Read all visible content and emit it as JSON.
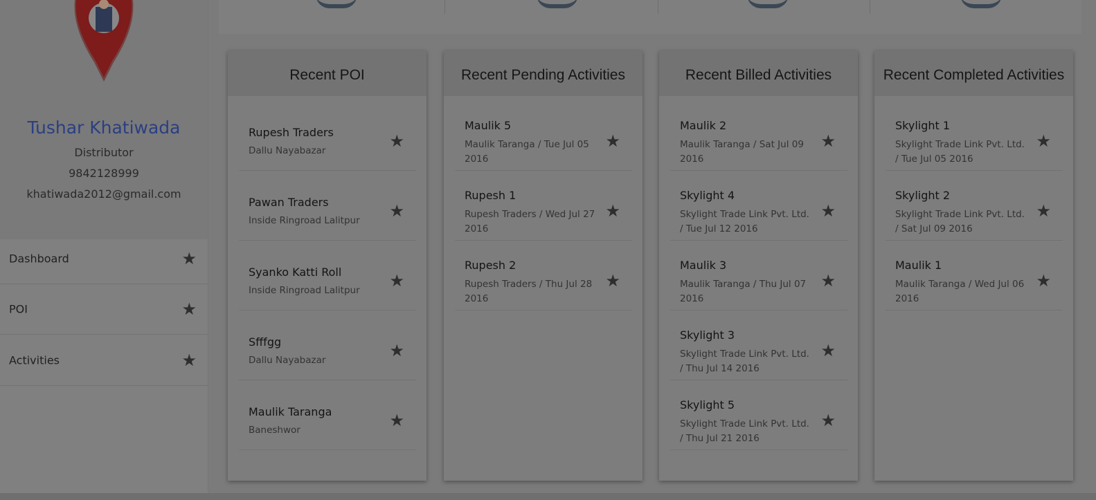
{
  "user": {
    "name": "Tushar Khatiwada",
    "role": "Distributor",
    "phone": "9842128999",
    "email": "khatiwada2012@gmail.com"
  },
  "nav": [
    {
      "label": "Dashboard",
      "icon": "star-icon"
    },
    {
      "label": "POI",
      "icon": "star-icon"
    },
    {
      "label": "Activities",
      "icon": "star-icon"
    }
  ],
  "icons": {
    "star": "★"
  },
  "colors": {
    "accent_name": "#2b3f82",
    "overlay": "#7b7b7b"
  },
  "panels": {
    "poi": {
      "title": "Recent POI",
      "items": [
        {
          "title": "Rupesh Traders",
          "sub": "Dallu Nayabazar"
        },
        {
          "title": "Pawan Traders",
          "sub": "Inside Ringroad Lalitpur"
        },
        {
          "title": "Syanko Katti Roll",
          "sub": "Inside Ringroad Lalitpur"
        },
        {
          "title": "Sfffgg",
          "sub": "Dallu Nayabazar"
        },
        {
          "title": "Maulik Taranga",
          "sub": "Baneshwor"
        }
      ]
    },
    "pending": {
      "title": "Recent Pending Activities",
      "items": [
        {
          "title": "Maulik 5",
          "sub": "Maulik Taranga / Tue Jul 05 2016"
        },
        {
          "title": "Rupesh 1",
          "sub": "Rupesh Traders / Wed Jul 27 2016"
        },
        {
          "title": "Rupesh 2",
          "sub": "Rupesh Traders / Thu Jul 28 2016"
        }
      ]
    },
    "billed": {
      "title": "Recent Billed Activities",
      "items": [
        {
          "title": "Maulik 2",
          "sub": "Maulik Taranga / Sat Jul 09 2016"
        },
        {
          "title": "Skylight 4",
          "sub": "Skylight Trade Link Pvt. Ltd. / Tue Jul 12 2016"
        },
        {
          "title": "Maulik 3",
          "sub": "Maulik Taranga / Thu Jul 07 2016"
        },
        {
          "title": "Skylight 3",
          "sub": "Skylight Trade Link Pvt. Ltd. / Thu Jul 14 2016"
        },
        {
          "title": "Skylight 5",
          "sub": "Skylight Trade Link Pvt. Ltd. / Thu Jul 21 2016"
        }
      ]
    },
    "completed": {
      "title": "Recent Completed Activities",
      "items": [
        {
          "title": "Skylight 1",
          "sub": "Skylight Trade Link Pvt. Ltd. / Tue Jul 05 2016"
        },
        {
          "title": "Skylight 2",
          "sub": "Skylight Trade Link Pvt. Ltd. / Sat Jul 09 2016"
        },
        {
          "title": "Maulik 1",
          "sub": "Maulik Taranga / Wed Jul 06 2016"
        }
      ]
    }
  }
}
